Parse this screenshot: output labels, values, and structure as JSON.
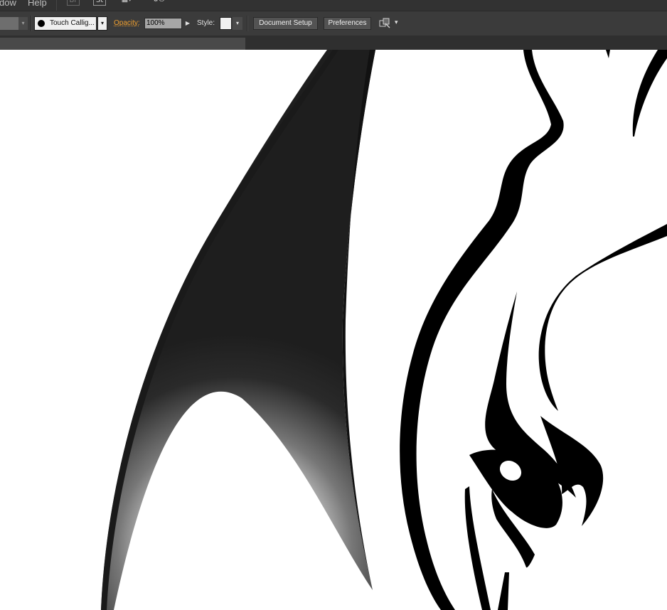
{
  "menubar": {
    "items": [
      "dow",
      "Help"
    ],
    "icons": [
      {
        "name": "bridge-icon",
        "glyph": "Br"
      },
      {
        "name": "stock-icon",
        "glyph": "St"
      },
      {
        "name": "arrange-documents-icon",
        "glyph": "▦▾"
      },
      {
        "name": "gpu-performance-icon",
        "glyph": "⚙⏻"
      }
    ]
  },
  "controlbar": {
    "stroke_arrow": "▾",
    "brush": {
      "name": "Touch Callig...",
      "arrow": "▾"
    },
    "opacity": {
      "label": "Opacity:",
      "value": "100%",
      "arrow": "▶"
    },
    "style": {
      "label": "Style:",
      "arrow": "▾"
    },
    "document_setup_label": "Document Setup",
    "preferences_label": "Preferences",
    "isolate_arrow": "▾"
  },
  "colors": {
    "ui_dark": "#323232",
    "ui_panel": "#3b3b3b",
    "accent_orange": "#f0a030",
    "artwork": "#000000"
  }
}
